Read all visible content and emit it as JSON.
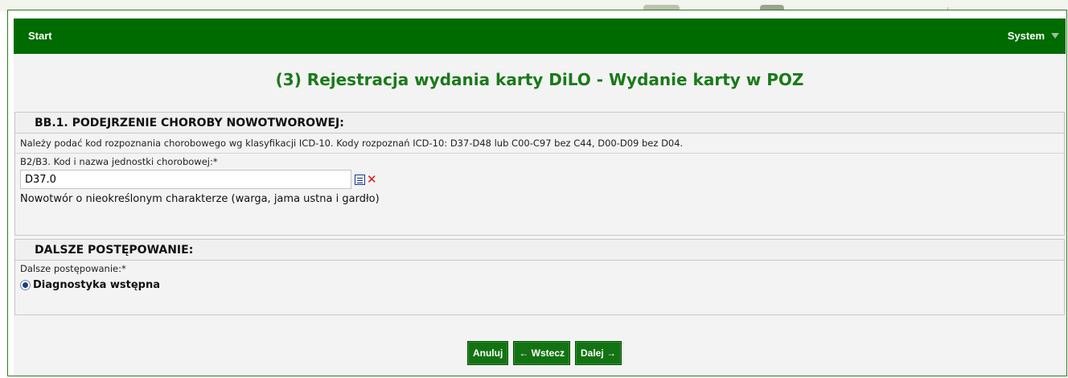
{
  "navbar": {
    "start": "Start",
    "system": "System"
  },
  "page": {
    "title": "(3) Rejestracja wydania karty DiLO - Wydanie karty w POZ"
  },
  "section1": {
    "title": "BB.1. PODEJRZENIE CHOROBY NOWOTWOROWEJ:",
    "info": "Należy podać kod rozpoznania chorobowego wg klasyfikacji ICD-10. Kody rozpoznań ICD-10: D37-D48 lub C00-C97 bez C44, D00-D09 bez D04.",
    "field_label": "B2/B3. Kod i nazwa jednostki chorobowej:*",
    "code_value": "D37.0",
    "clear_symbol": "✕",
    "description": "Nowotwór o nieokreślonym charakterze (warga, jama ustna i gardło)"
  },
  "section2": {
    "title": "DALSZE POSTĘPOWANIE:",
    "field_label": "Dalsze postępowanie:*",
    "option_label": "Diagnostyka wstępna",
    "option_selected": true
  },
  "buttons": {
    "cancel": "Anuluj",
    "back": "← Wstecz",
    "next": "Dalej →"
  },
  "colors": {
    "navbar": "#006b00",
    "title": "#1a7a1a",
    "button": "#137313",
    "clear_icon": "#e01010"
  },
  "icons": {
    "dropdown": "caret-down-icon",
    "list": "list-icon",
    "clear": "close-icon"
  }
}
